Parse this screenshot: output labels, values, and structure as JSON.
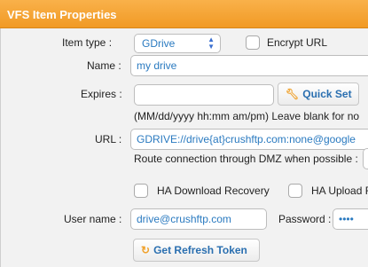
{
  "window": {
    "title": "VFS Item Properties"
  },
  "item_type": {
    "label": "Item type :",
    "value": "GDrive"
  },
  "encrypt_url": {
    "label": "Encrypt URL",
    "checked": false
  },
  "name": {
    "label": "Name :",
    "value": "my drive"
  },
  "expires": {
    "label": "Expires :",
    "value": "",
    "quick_set_label": "Quick Set",
    "hint": "(MM/dd/yyyy hh:mm am/pm) Leave blank for no"
  },
  "url": {
    "label": "URL :",
    "value": "GDRIVE://drive{at}crushftp.com:none@google"
  },
  "dmz": {
    "label": "Route connection through DMZ when possible :"
  },
  "ha_download_recovery": {
    "label": "HA Download Recovery",
    "checked": false
  },
  "ha_upload": {
    "label": "HA Upload F",
    "checked": false
  },
  "user_name": {
    "label": "User name :",
    "value": "drive@crushftp.com"
  },
  "password": {
    "label": "Password :",
    "value": "••••"
  },
  "refresh_token": {
    "label": "Get Refresh Token"
  },
  "colors": {
    "title_bar": "#f5a432",
    "link_text": "#2a7ac0",
    "panel_bg": "#f2f2f2"
  }
}
